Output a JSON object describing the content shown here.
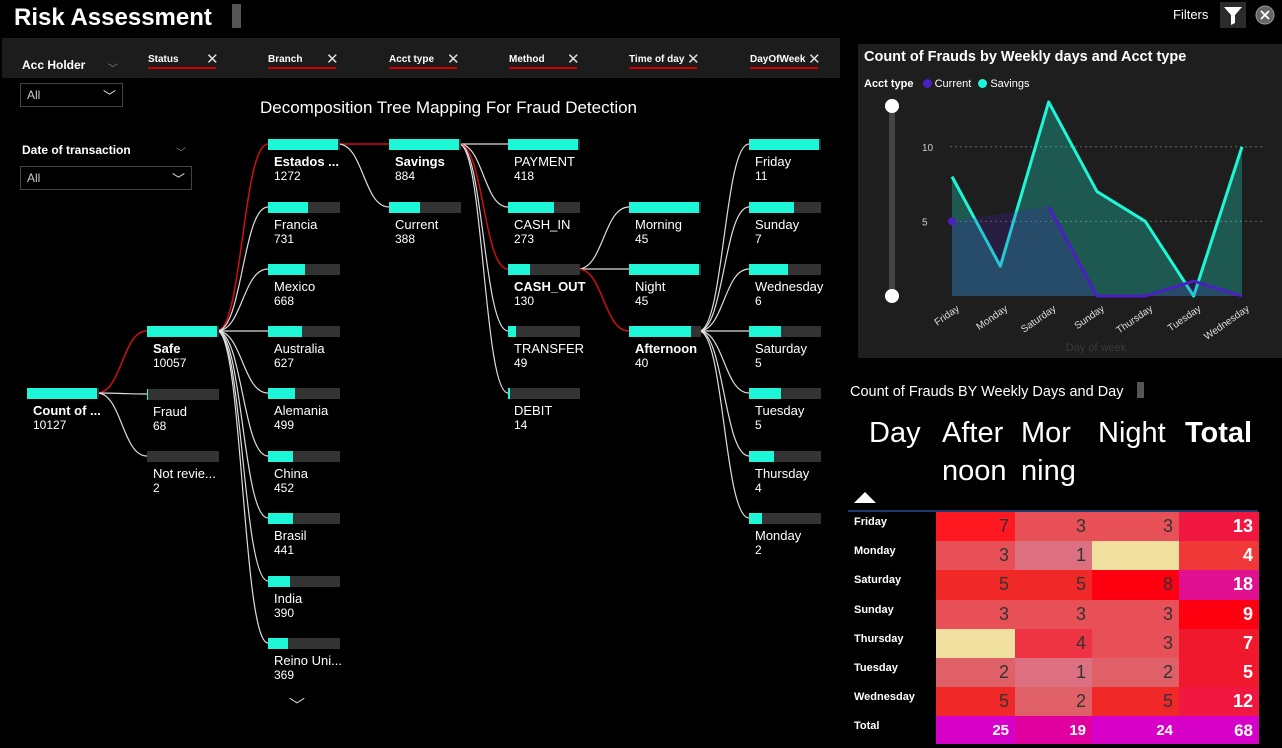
{
  "header": {
    "title": "Risk Assessment",
    "filters_label": "Filters"
  },
  "filter_bar": {
    "fields": [
      "Status",
      "Branch",
      "Acct type",
      "Method",
      "Time of day",
      "DayOfWeek"
    ]
  },
  "slicers": {
    "acc_holder": {
      "label": "Acc Holder",
      "value": "All"
    },
    "date": {
      "label": "Date of transaction",
      "value": "All"
    }
  },
  "tree": {
    "title": "Decomposition Tree Mapping For Fraud Detection",
    "root": {
      "label": "Count of ...",
      "value": "10127"
    },
    "status": [
      {
        "label": "Safe",
        "value": "10057",
        "fill": 1.0,
        "bold": true
      },
      {
        "label": "Fraud",
        "value": "68",
        "fill": 0.01,
        "bold": false
      },
      {
        "label": "Not revie...",
        "value": "2",
        "fill": 0.0,
        "bold": false
      }
    ],
    "branch": [
      {
        "label": "Estados ...",
        "value": "1272",
        "fill": 1.0,
        "bold": true
      },
      {
        "label": "Francia",
        "value": "731",
        "fill": 0.57,
        "bold": false
      },
      {
        "label": "Mexico",
        "value": "668",
        "fill": 0.53,
        "bold": false
      },
      {
        "label": "Australia",
        "value": "627",
        "fill": 0.49,
        "bold": false
      },
      {
        "label": "Alemania",
        "value": "499",
        "fill": 0.39,
        "bold": false
      },
      {
        "label": "China",
        "value": "452",
        "fill": 0.36,
        "bold": false
      },
      {
        "label": "Brasil",
        "value": "441",
        "fill": 0.35,
        "bold": false
      },
      {
        "label": "India",
        "value": "390",
        "fill": 0.31,
        "bold": false
      },
      {
        "label": "Reino Uni...",
        "value": "369",
        "fill": 0.29,
        "bold": false
      }
    ],
    "acct": [
      {
        "label": "Savings",
        "value": "884",
        "fill": 1.0,
        "bold": true
      },
      {
        "label": "Current",
        "value": "388",
        "fill": 0.44,
        "bold": false
      }
    ],
    "method": [
      {
        "label": "PAYMENT",
        "value": "418",
        "fill": 1.0,
        "bold": false
      },
      {
        "label": "CASH_IN",
        "value": "273",
        "fill": 0.65,
        "bold": false
      },
      {
        "label": "CASH_OUT",
        "value": "130",
        "fill": 0.31,
        "bold": true
      },
      {
        "label": "TRANSFER",
        "value": "49",
        "fill": 0.12,
        "bold": false
      },
      {
        "label": "DEBIT",
        "value": "14",
        "fill": 0.03,
        "bold": false
      }
    ],
    "time": [
      {
        "label": "Morning",
        "value": "45",
        "fill": 1.0,
        "bold": false
      },
      {
        "label": "Night",
        "value": "45",
        "fill": 1.0,
        "bold": false
      },
      {
        "label": "Afternoon",
        "value": "40",
        "fill": 0.89,
        "bold": true
      }
    ],
    "day": [
      {
        "label": "Friday",
        "value": "11",
        "fill": 1.0,
        "bold": false
      },
      {
        "label": "Sunday",
        "value": "7",
        "fill": 0.64,
        "bold": false
      },
      {
        "label": "Wednesday",
        "value": "6",
        "fill": 0.55,
        "bold": false
      },
      {
        "label": "Saturday",
        "value": "5",
        "fill": 0.45,
        "bold": false
      },
      {
        "label": "Tuesday",
        "value": "5",
        "fill": 0.45,
        "bold": false
      },
      {
        "label": "Thursday",
        "value": "4",
        "fill": 0.36,
        "bold": false
      },
      {
        "label": "Monday",
        "value": "2",
        "fill": 0.18,
        "bold": false
      }
    ]
  },
  "chart_data": [
    {
      "type": "area",
      "title": "Count of Frauds by Weekly days and Acct type",
      "xlabel": "Day of week",
      "ylabel": "",
      "legend_title": "Acct type",
      "legend_position": "top-left",
      "categories": [
        "Friday",
        "Monday",
        "Saturday",
        "Sunday",
        "Thursday",
        "Tuesday",
        "Wednesday"
      ],
      "ylim": [
        0,
        13
      ],
      "yticks": [
        5,
        10
      ],
      "grid": true,
      "series": [
        {
          "name": "Current",
          "color": "#4b1fc2",
          "values": [
            5,
            null,
            6,
            0,
            0,
            1,
            0
          ]
        },
        {
          "name": "Savings",
          "color": "#1ef6d8",
          "values": [
            8,
            2,
            13,
            7,
            5,
            0,
            10
          ]
        }
      ]
    },
    {
      "type": "heatmap",
      "title": "Count of Frauds BY Weekly Days and Day",
      "columns": [
        "Day",
        "After noon",
        "Mor ning",
        "Night",
        "Total"
      ],
      "rows": [
        {
          "label": "Friday",
          "values": [
            "7",
            "3",
            "3",
            "13"
          ]
        },
        {
          "label": "Monday",
          "values": [
            "3",
            "1",
            "",
            "4"
          ]
        },
        {
          "label": "Saturday",
          "values": [
            "5",
            "5",
            "8",
            "18"
          ]
        },
        {
          "label": "Sunday",
          "values": [
            "3",
            "3",
            "3",
            "9"
          ]
        },
        {
          "label": "Thursday",
          "values": [
            "",
            "4",
            "3",
            "7"
          ]
        },
        {
          "label": "Tuesday",
          "values": [
            "2",
            "1",
            "2",
            "5"
          ]
        },
        {
          "label": "Wednesday",
          "values": [
            "5",
            "2",
            "5",
            "12"
          ]
        }
      ],
      "totals": {
        "label": "Total",
        "values": [
          "25",
          "19",
          "24",
          "68"
        ]
      },
      "colors": {
        "empty": "#f0e0a0",
        "low": "#dc7080",
        "mid": "#e85058",
        "high": "#ff1820",
        "max": "#ff0010",
        "total_mid": "#f0182c",
        "total_high": "#e01090",
        "footer": "#d600c8",
        "footer_alt": "#e000a0"
      }
    }
  ]
}
